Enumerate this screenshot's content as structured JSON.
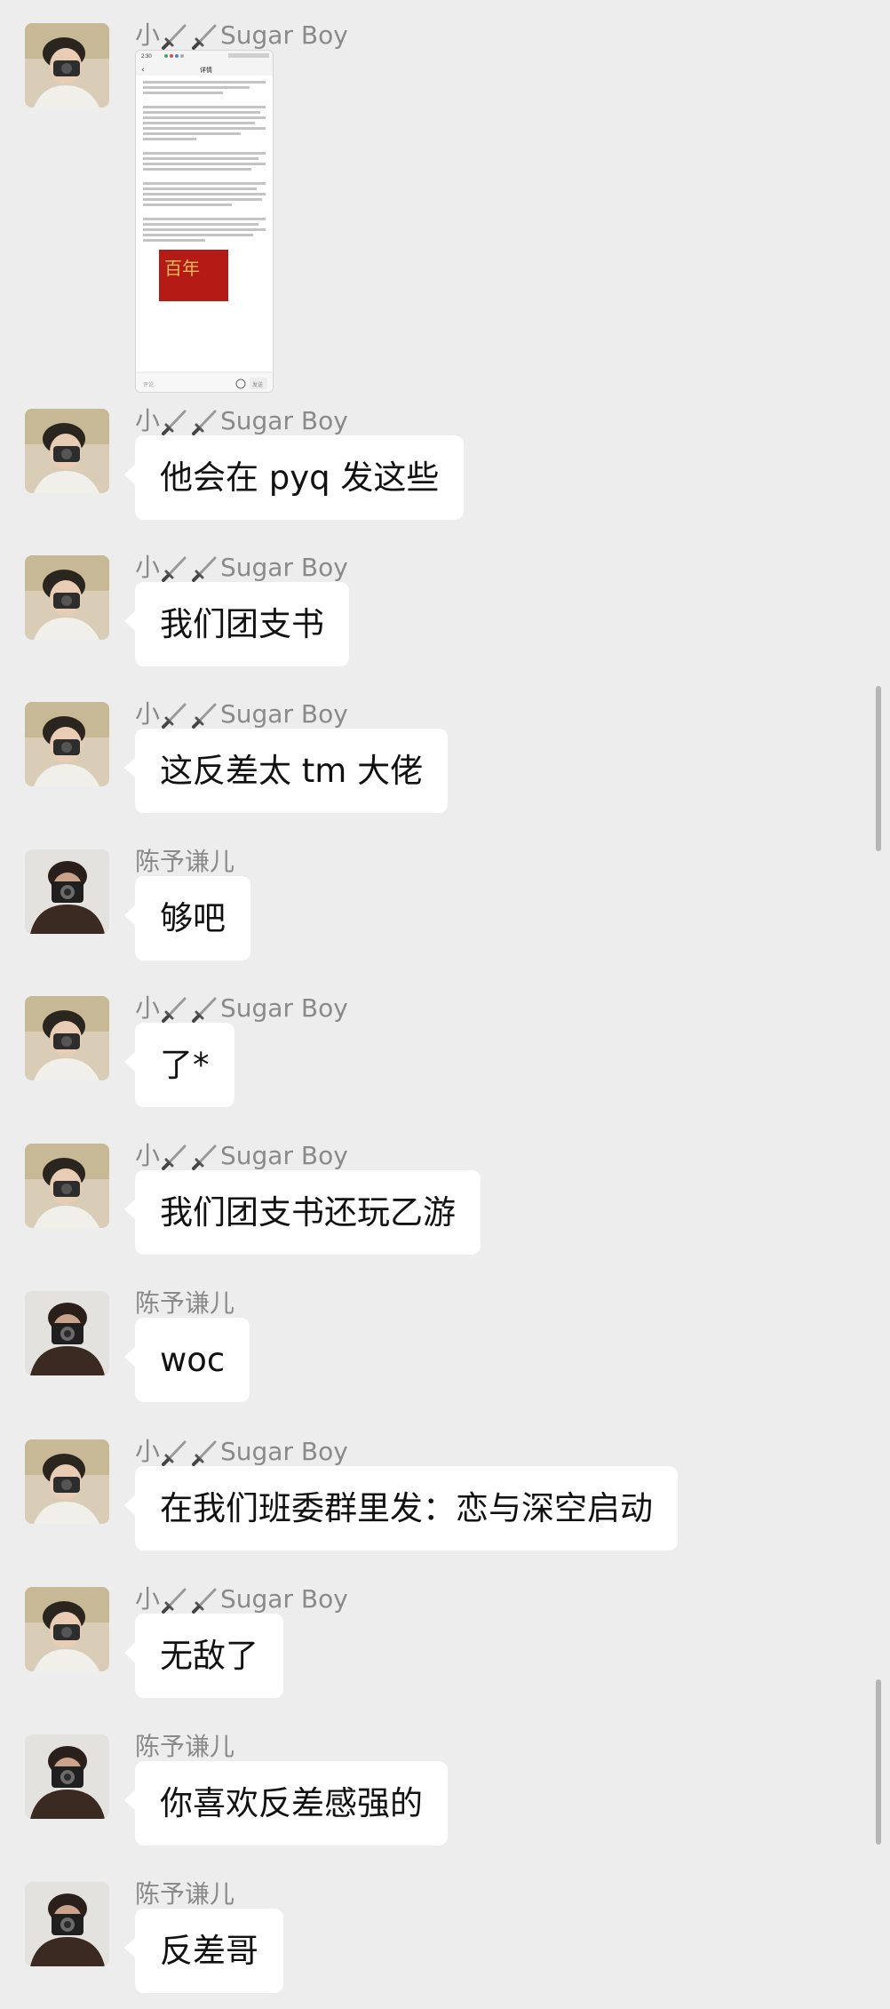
{
  "chat": {
    "messages": [
      {
        "sender": "小",
        "sender_suffix": "Sugar Boy",
        "type": "image",
        "text": "",
        "image": {
          "status_time": "2:30",
          "title": "详情",
          "input_placeholder": "评论",
          "send_label": "发送",
          "poster_chars": "百年"
        }
      },
      {
        "sender": "小",
        "sender_suffix": "Sugar Boy",
        "type": "text",
        "text": "他会在 pyq 发这些"
      },
      {
        "sender": "小",
        "sender_suffix": "Sugar Boy",
        "type": "text",
        "text": "我们团支书"
      },
      {
        "sender": "小",
        "sender_suffix": "Sugar Boy",
        "type": "text",
        "text": "这反差太 tm 大佬"
      },
      {
        "sender": "陈予谦儿",
        "sender_suffix": "",
        "type": "text",
        "text": "够吧"
      },
      {
        "sender": "小",
        "sender_suffix": "Sugar Boy",
        "type": "text",
        "text": "了*"
      },
      {
        "sender": "小",
        "sender_suffix": "Sugar Boy",
        "type": "text",
        "text": "我们团支书还玩乙游"
      },
      {
        "sender": "陈予谦儿",
        "sender_suffix": "",
        "type": "text",
        "text": "woc"
      },
      {
        "sender": "小",
        "sender_suffix": "Sugar Boy",
        "type": "text",
        "text": "在我们班委群里发：恋与深空启动"
      },
      {
        "sender": "小",
        "sender_suffix": "Sugar Boy",
        "type": "text",
        "text": "无敌了"
      },
      {
        "sender": "陈予谦儿",
        "sender_suffix": "",
        "type": "text",
        "text": "你喜欢反差感强的"
      },
      {
        "sender": "陈予谦儿",
        "sender_suffix": "",
        "type": "text",
        "text": "反差哥"
      }
    ]
  },
  "icons": {
    "sender_emoji": "dagger-icon"
  },
  "colors": {
    "background": "#ededed",
    "bubble": "#ffffff",
    "sender_name": "#8a8a8a",
    "poster": "#b31b14"
  }
}
